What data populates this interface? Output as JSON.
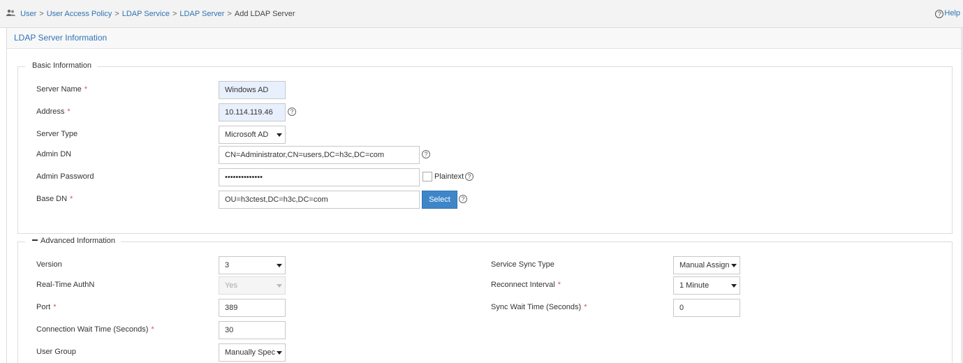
{
  "breadcrumb": {
    "items": [
      "User",
      "User Access Policy",
      "LDAP Service",
      "LDAP Server"
    ],
    "current": "Add LDAP Server",
    "separator": ">"
  },
  "help": {
    "label": "Help",
    "icon": "question-circle-icon"
  },
  "panel": {
    "title": "LDAP Server Information"
  },
  "basic": {
    "legend": "Basic Information",
    "server_name": {
      "label": "Server Name",
      "required": "*",
      "value": "Windows AD"
    },
    "address": {
      "label": "Address",
      "required": "*",
      "value": "10.114.119.46"
    },
    "server_type": {
      "label": "Server Type",
      "value": "Microsoft AD"
    },
    "admin_dn": {
      "label": "Admin DN",
      "value": "CN=Administrator,CN=users,DC=h3c,DC=com"
    },
    "admin_password": {
      "label": "Admin Password",
      "value": "••••••••••••••",
      "plaintext_label": "Plaintext"
    },
    "base_dn": {
      "label": "Base DN",
      "required": "*",
      "value": "OU=h3ctest,DC=h3c,DC=com",
      "select_label": "Select"
    }
  },
  "advanced": {
    "legend": "Advanced Information",
    "version": {
      "label": "Version",
      "value": "3"
    },
    "realtime_authn": {
      "label": "Real-Time AuthN",
      "value": "Yes"
    },
    "port": {
      "label": "Port",
      "required": "*",
      "value": "389"
    },
    "conn_wait": {
      "label": "Connection Wait Time (Seconds)",
      "required": "*",
      "value": "30"
    },
    "user_group": {
      "label": "User Group",
      "value": "Manually Spec"
    },
    "sync_type": {
      "label": "Service Sync Type",
      "value": "Manual Assign"
    },
    "reconnect": {
      "label": "Reconnect Interval",
      "required": "*",
      "value": "1 Minute"
    },
    "sync_wait": {
      "label": "Sync Wait Time (Seconds)",
      "required": "*",
      "value": "0"
    }
  },
  "colors": {
    "link": "#2f72b5",
    "button": "#3f86c9",
    "required": "#d9534f",
    "highlight": "#e8f0fe"
  }
}
